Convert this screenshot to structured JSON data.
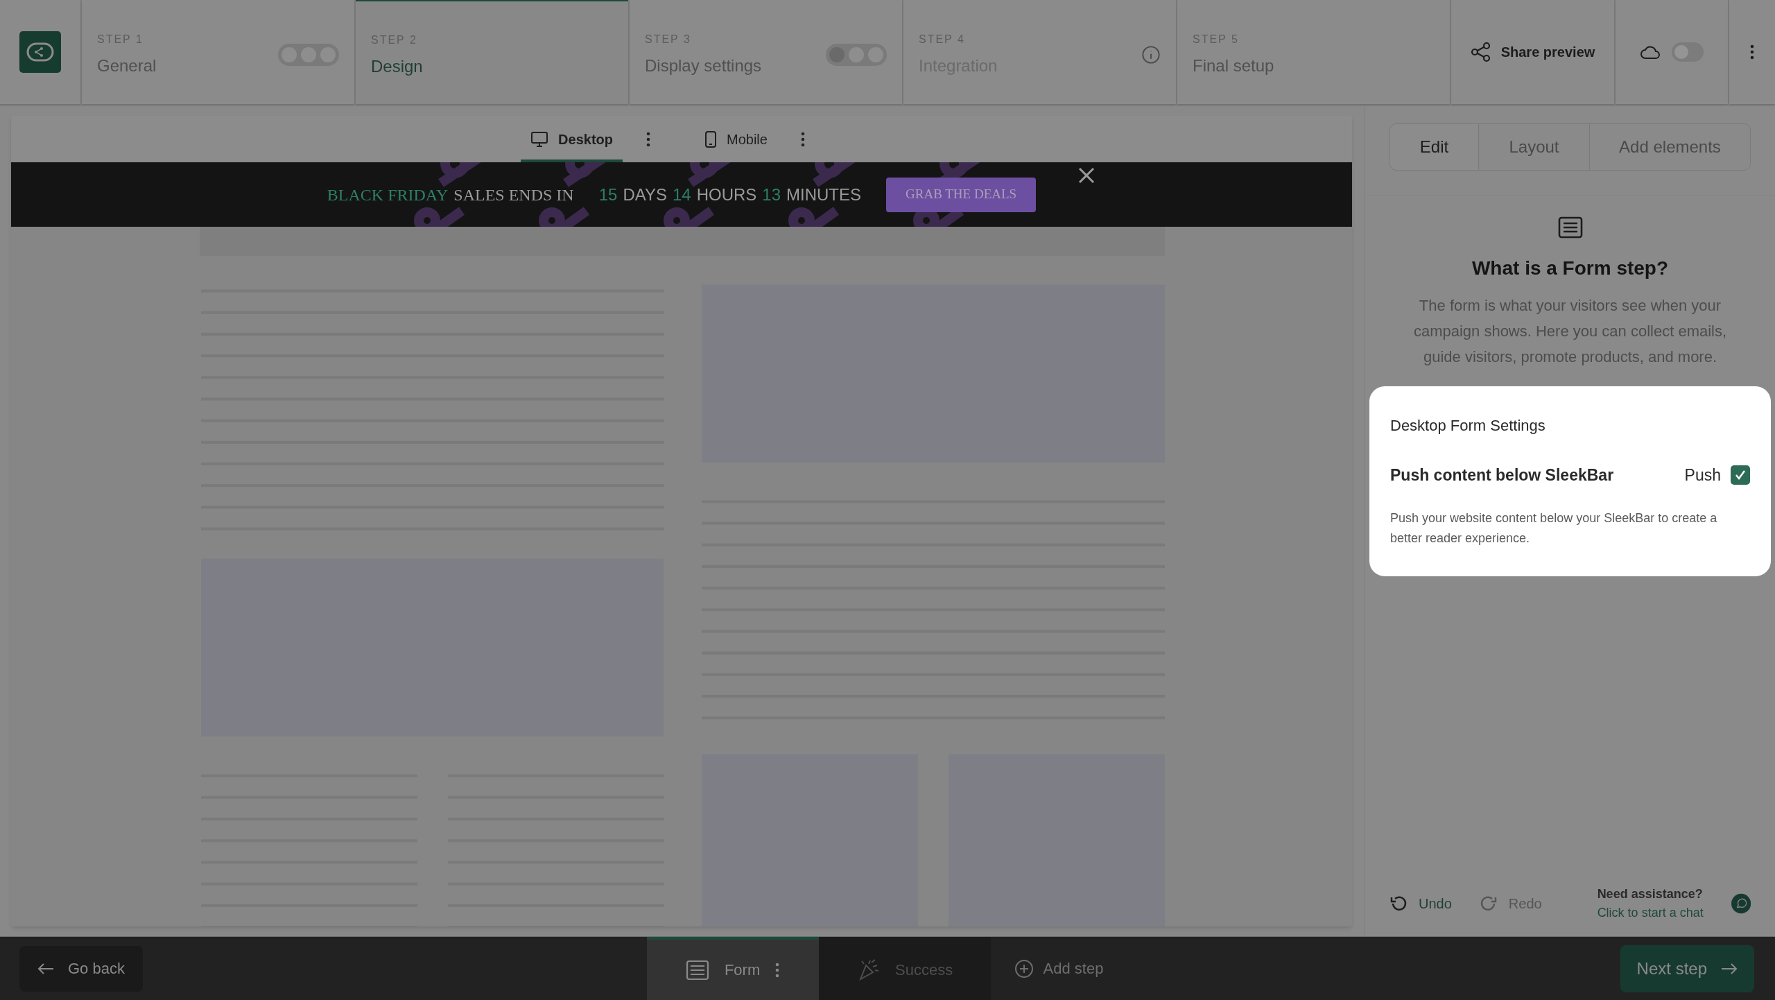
{
  "steps": [
    {
      "label": "STEP 1",
      "title": "General",
      "selected": false,
      "disabled": false,
      "kind": "dots",
      "dots": [
        {
          "on": false
        },
        {
          "on": false
        },
        {
          "on": false
        }
      ]
    },
    {
      "label": "STEP 2",
      "title": "Design",
      "selected": true,
      "disabled": false,
      "kind": "plain"
    },
    {
      "label": "STEP 3",
      "title": "Display settings",
      "selected": false,
      "disabled": false,
      "kind": "dots",
      "dots": [
        {
          "on": true
        },
        {
          "on": false
        },
        {
          "on": false
        }
      ]
    },
    {
      "label": "STEP 4",
      "title": "Integration",
      "selected": false,
      "disabled": true,
      "kind": "info"
    },
    {
      "label": "STEP 5",
      "title": "Final setup",
      "selected": false,
      "disabled": false,
      "kind": "plain"
    }
  ],
  "share_button": {
    "label": "Share preview"
  },
  "autosave_toggle": {
    "on": false
  },
  "device_tabs": [
    {
      "label": "Desktop",
      "kind": "desktop",
      "selected": true
    },
    {
      "label": "Mobile",
      "kind": "mobile",
      "selected": false
    }
  ],
  "banner": {
    "headline": [
      {
        "text": "BLACK FRIDAY",
        "highlight": true
      },
      {
        "text": "SALES ENDS IN",
        "highlight": false
      }
    ],
    "countdown": [
      {
        "value": "15",
        "unit": "DAYS"
      },
      {
        "value": "14",
        "unit": "HOURS"
      },
      {
        "value": "13",
        "unit": "MINUTES"
      }
    ],
    "button": "GRAB THE DEALS"
  },
  "panel_tabs": [
    {
      "label": "Edit",
      "selected": true
    },
    {
      "label": "Layout",
      "selected": false
    },
    {
      "label": "Add elements",
      "selected": false
    }
  ],
  "info": {
    "title": "What is a Form step?",
    "text": "The form is what your visitors see when your campaign shows. Here you can collect emails, guide visitors, promote products, and more."
  },
  "settings_popover": {
    "title": "Desktop Form Settings",
    "option_label": "Push content below SleekBar",
    "checkbox_label": "Push",
    "checked": true,
    "description": "Push your website content below your SleekBar to create a better reader experience."
  },
  "history": [
    {
      "label": "Undo",
      "kind": "undo",
      "disabled": false
    },
    {
      "label": "Redo",
      "kind": "redo",
      "disabled": true
    }
  ],
  "assistance": {
    "title": "Need assistance?",
    "link": "Click to start a chat"
  },
  "bottom_bar": {
    "back": "Go back",
    "steps": [
      {
        "label": "Form",
        "kind": "form",
        "selected": true
      },
      {
        "label": "Success",
        "kind": "success",
        "selected": false
      }
    ],
    "add_step": "Add step",
    "next": "Next step"
  }
}
